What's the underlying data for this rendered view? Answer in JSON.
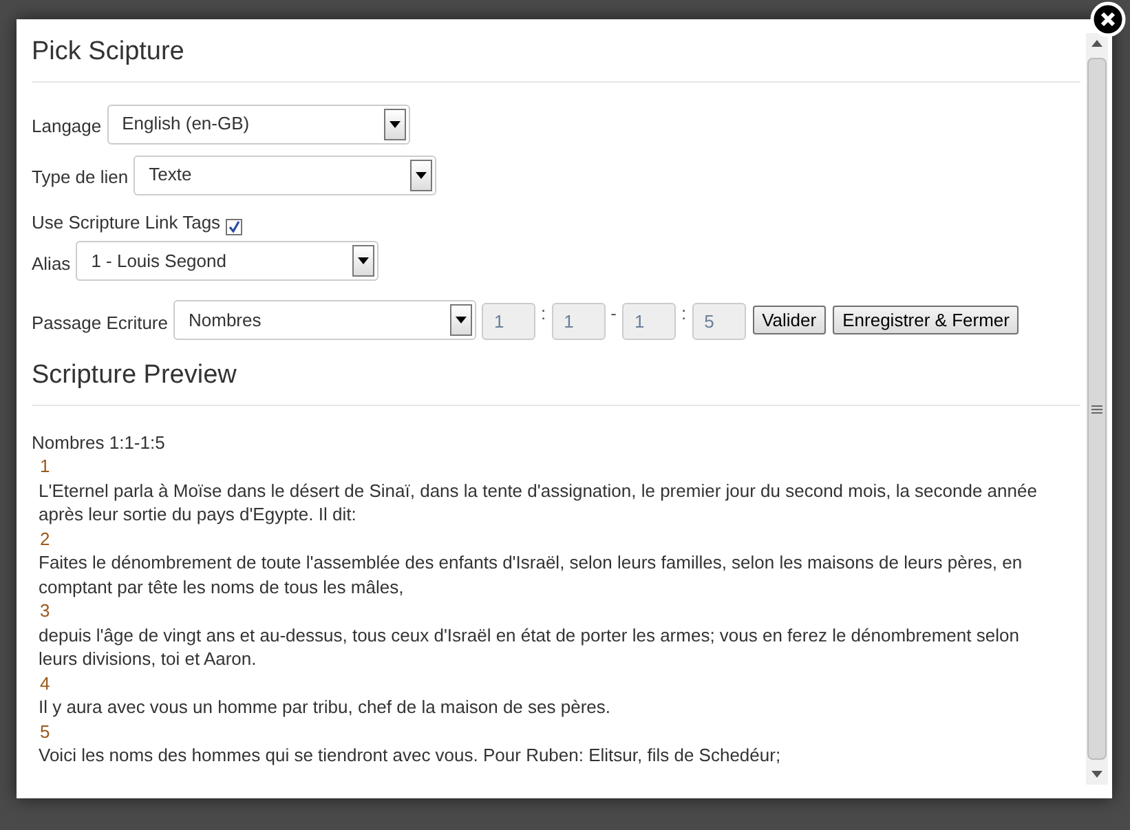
{
  "dialog": {
    "title": "Pick Scipture"
  },
  "form": {
    "language": {
      "label": "Langage",
      "value": "English (en-GB)"
    },
    "link_type": {
      "label": "Type de lien",
      "value": "Texte"
    },
    "link_tags": {
      "label": "Use Scripture Link Tags",
      "checked": true
    },
    "alias": {
      "label": "Alias",
      "value": "1 - Louis Segond"
    },
    "passage": {
      "label": "Passage Ecriture",
      "book": "Nombres",
      "fields": [
        {
          "value": "1",
          "disabled": true
        },
        {
          "separator": ":",
          "value": "1",
          "disabled": true
        },
        {
          "separator": "-",
          "value": "1",
          "disabled": true
        },
        {
          "separator": ":",
          "value": "5",
          "disabled": true
        }
      ]
    },
    "buttons": [
      "Valider",
      "Enregistrer & Fermer"
    ]
  },
  "preview": {
    "title": "Scripture Preview",
    "reference": "Nombres 1:1-1:5",
    "verses": [
      {
        "number": "1",
        "text": "L'Eternel parla à Moïse dans le désert de Sinaï, dans la tente d'assignation, le premier jour du second mois, la seconde année après leur sortie du pays d'Egypte. Il dit:"
      },
      {
        "number": "2",
        "text": "Faites le dénombrement de toute l'assemblée des enfants d'Israël, selon leurs familles, selon les maisons de leurs pères, en comptant par tête les noms de tous les mâles,"
      },
      {
        "number": "3",
        "text": "depuis l'âge de vingt ans et au-dessus, tous ceux d'Israël en état de porter les armes; vous en ferez le dénombrement selon leurs divisions, toi et Aaron."
      },
      {
        "number": "4",
        "text": "Il y aura avec vous un homme par tribu, chef de la maison de ses pères."
      },
      {
        "number": "5",
        "text": "Voici les noms des hommes qui se tiendront avec vous. Pour Ruben: Elitsur, fils de Schedéur;"
      }
    ]
  }
}
